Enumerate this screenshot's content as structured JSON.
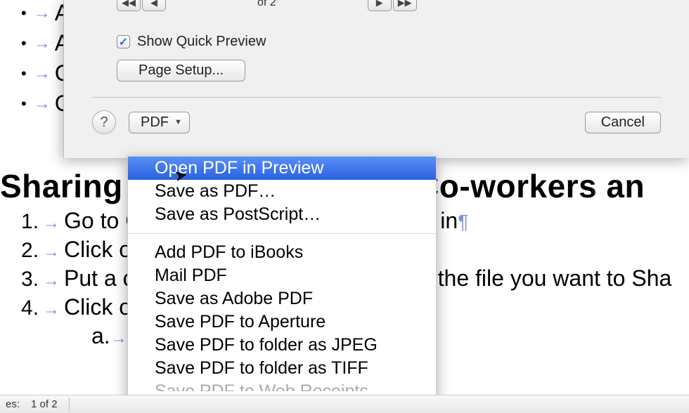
{
  "document": {
    "bullets": [
      "A",
      "A",
      "C",
      "C"
    ],
    "heading": "Sharing",
    "heading_right": "Co-workers an",
    "numbered": [
      "Go to C",
      "Click o",
      "Put a c",
      "Click on"
    ],
    "numbered_right": [
      "in",
      "",
      "the file you want to Sha",
      ""
    ],
    "subitem": "a.",
    "middot_text": "· · · · · · · · · · · · · · · · · · · · · · · · · · · · · ·"
  },
  "dialog": {
    "page_indicator": "of 2",
    "show_preview_label": "Show Quick Preview",
    "page_setup_label": "Page Setup...",
    "help_label": "?",
    "pdf_label": "PDF",
    "cancel_label": "Cancel"
  },
  "menu": {
    "items": [
      "Open PDF in Preview",
      "Save as PDF…",
      "Save as PostScript…"
    ],
    "items2": [
      "Add PDF to iBooks",
      "Mail PDF",
      "Save as Adobe PDF",
      "Save PDF to Aperture",
      "Save PDF to folder as JPEG",
      "Save PDF to folder as TIFF"
    ],
    "partial": "Save PDF to Web Receipts Folder"
  },
  "status": {
    "label": "es:",
    "pages": "1 of 2"
  }
}
